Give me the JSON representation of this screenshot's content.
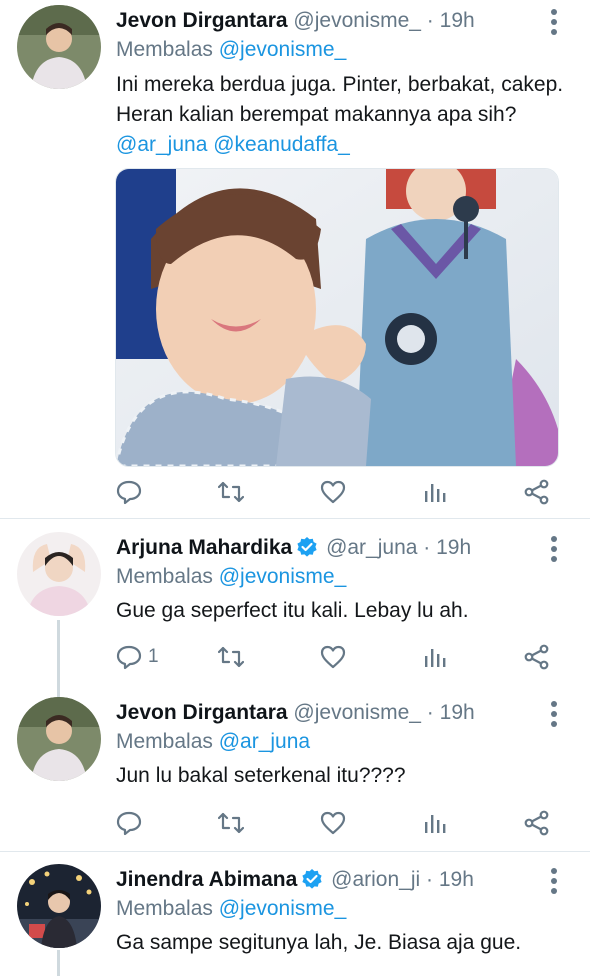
{
  "tweets": [
    {
      "name": "Jevon Dirgantara",
      "verified": false,
      "handle": "@jevonisme_",
      "sep": "·",
      "time": "19h",
      "reply_prefix": "Membalas",
      "reply_to": "@jevonisme_",
      "text_plain": "Ini mereka berdua juga. Pinter, berbakat, cakep. Heran kalian berempat makannya apa sih?",
      "mention1": "@ar_juna",
      "mention2": "@keanudaffa_",
      "has_media": true,
      "reply_count": ""
    },
    {
      "name": "Arjuna Mahardika",
      "verified": true,
      "handle": "@ar_juna",
      "sep": "·",
      "time": "19h",
      "reply_prefix": "Membalas",
      "reply_to": "@jevonisme_",
      "text": "Gue ga seperfect itu kali. Lebay lu ah.",
      "reply_count": "1"
    },
    {
      "name": "Jevon Dirgantara",
      "verified": false,
      "handle": "@jevonisme_",
      "sep": "·",
      "time": "19h",
      "reply_prefix": "Membalas",
      "reply_to": "@ar_juna",
      "text": "Jun lu bakal seterkenal itu????",
      "reply_count": ""
    },
    {
      "name": "Jinendra Abimana",
      "verified": true,
      "handle": "@arion_ji",
      "sep": "·",
      "time": "19h",
      "reply_prefix": "Membalas",
      "reply_to": "@jevonisme_",
      "text": "Ga sampe segitunya lah, Je. Biasa aja gue.",
      "reply_count": ""
    }
  ],
  "icons": {
    "reply": "reply-icon",
    "retweet": "retweet-icon",
    "like": "heart-icon",
    "analytics": "analytics-icon",
    "share": "share-icon",
    "more": "more-vertical-icon",
    "verified": "verified-badge-icon"
  },
  "colors": {
    "link": "#1b95e0",
    "secondary": "#657786",
    "verified": "#1da1f2",
    "divider": "#e1e8ed"
  }
}
